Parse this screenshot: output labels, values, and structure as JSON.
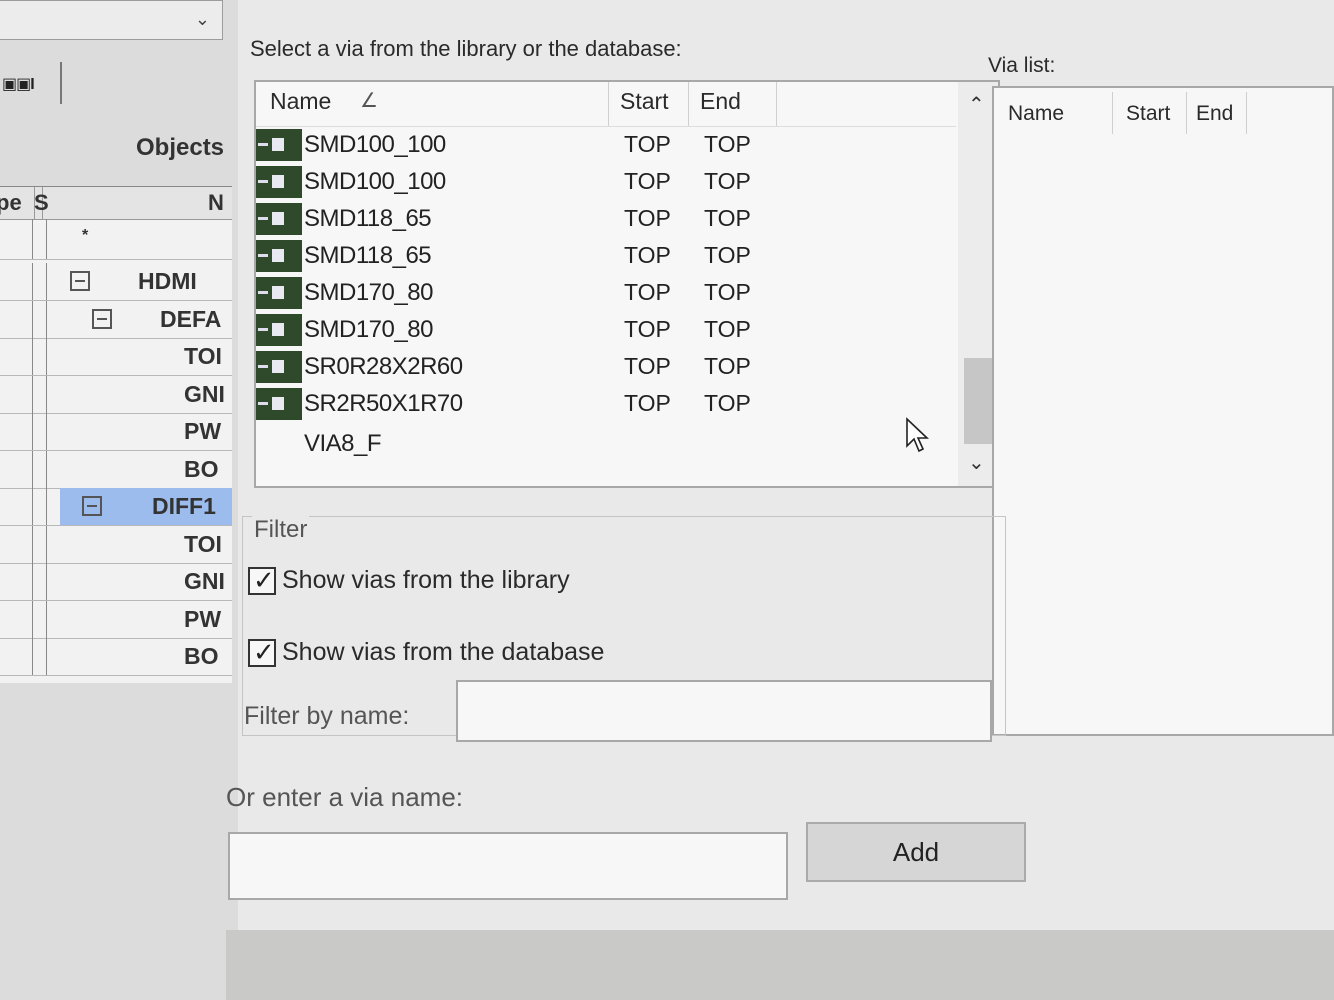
{
  "left": {
    "toolbar_glyph": "▣▣I",
    "objects_label": "Objects",
    "grid_headers": [
      "pe",
      "S",
      "N"
    ],
    "filter_row_glyph": "*",
    "rows": [
      {
        "label": "HDMI",
        "level": 0,
        "expandable": true,
        "selected": false
      },
      {
        "label": "DEFA",
        "level": 1,
        "expandable": true,
        "selected": false
      },
      {
        "label": "TOI",
        "level": 2,
        "expandable": false,
        "selected": false
      },
      {
        "label": "GNI",
        "level": 2,
        "expandable": false,
        "selected": false
      },
      {
        "label": "PW",
        "level": 2,
        "expandable": false,
        "selected": false
      },
      {
        "label": "BO",
        "level": 2,
        "expandable": false,
        "selected": false
      },
      {
        "label": "DIFF1",
        "level": 1,
        "expandable": true,
        "selected": true
      },
      {
        "label": "TOI",
        "level": 2,
        "expandable": false,
        "selected": false
      },
      {
        "label": "GNI",
        "level": 2,
        "expandable": false,
        "selected": false
      },
      {
        "label": "PW",
        "level": 2,
        "expandable": false,
        "selected": false
      },
      {
        "label": "BO",
        "level": 2,
        "expandable": false,
        "selected": false
      }
    ]
  },
  "dialog": {
    "select_label": "Select a via from the library or the database:",
    "via_list_label": "Via list:",
    "library": {
      "headers": {
        "name": "Name",
        "start": "Start",
        "end": "End"
      },
      "sort_mark": "∠",
      "rows": [
        {
          "name": "SMD100_100",
          "start": "TOP",
          "end": "TOP",
          "icon": true
        },
        {
          "name": "SMD100_100",
          "start": "TOP",
          "end": "TOP",
          "icon": true
        },
        {
          "name": "SMD118_65",
          "start": "TOP",
          "end": "TOP",
          "icon": true
        },
        {
          "name": "SMD118_65",
          "start": "TOP",
          "end": "TOP",
          "icon": true
        },
        {
          "name": "SMD170_80",
          "start": "TOP",
          "end": "TOP",
          "icon": true
        },
        {
          "name": "SMD170_80",
          "start": "TOP",
          "end": "TOP",
          "icon": true
        },
        {
          "name": "SR0R28X2R60",
          "start": "TOP",
          "end": "TOP",
          "icon": true
        },
        {
          "name": "SR2R50X1R70",
          "start": "TOP",
          "end": "TOP",
          "icon": true
        },
        {
          "name": "VIA8_F",
          "start": "",
          "end": "",
          "icon": false
        }
      ]
    },
    "via_list": {
      "headers": {
        "name": "Name",
        "start": "Start",
        "end": "End"
      }
    },
    "filter": {
      "title": "Filter",
      "show_library": {
        "label": "Show vias from the library",
        "checked": true
      },
      "show_database": {
        "label": "Show vias from the database",
        "checked": true
      },
      "name_label": "Filter by name:",
      "name_value": ""
    },
    "enter_label": "Or enter a via name:",
    "enter_value": "",
    "add_label": "Add"
  }
}
